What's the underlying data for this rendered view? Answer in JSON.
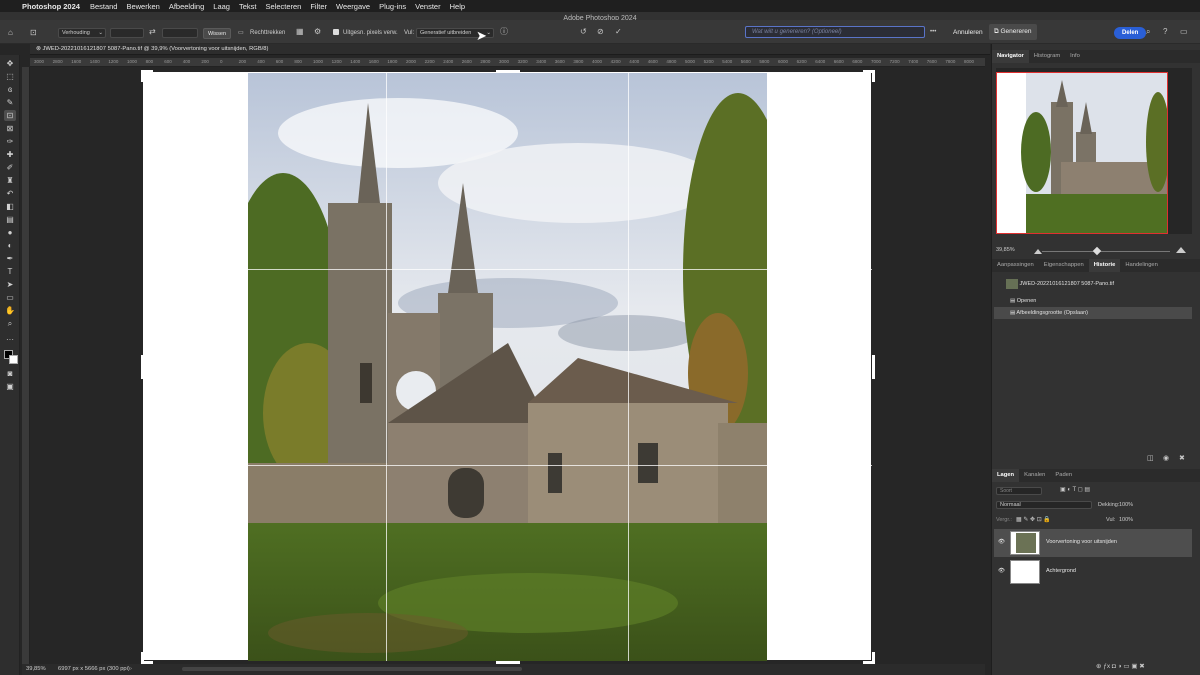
{
  "menubar": {
    "apple": "",
    "app_name": "Photoshop 2024",
    "items": [
      "Bestand",
      "Bewerken",
      "Afbeelding",
      "Laag",
      "Tekst",
      "Selecteren",
      "Filter",
      "Weergave",
      "Plug-ins",
      "Venster",
      "Help"
    ]
  },
  "window_title": "Adobe Photoshop 2024",
  "options": {
    "ratio_label": "Verhouding",
    "clear_label": "Wissen",
    "straighten_label": "Rechttrekken",
    "delete_pixels_label": "Uitgesn. pixels verw.",
    "fill_label": "Vul:",
    "fill_value": "Generatief uitbreiden",
    "prompt_placeholder": "Wat wilt u genereren? (Optioneel)",
    "more_label": "•••",
    "cancel_label": "Annuleren",
    "generate_label": "Genereren",
    "share_label": "Delen"
  },
  "document": {
    "tab_title": "JWED-20221016121807 5087-Pano.tif @ 39,9% (Voorvertoning voor uitsnijden, RGB/8)"
  },
  "ruler": {
    "ticks": [
      "3000",
      "2800",
      "1600",
      "1400",
      "1200",
      "1000",
      "800",
      "600",
      "400",
      "200",
      "0",
      "200",
      "400",
      "600",
      "800",
      "1000",
      "1200",
      "1400",
      "1600",
      "1800",
      "2000",
      "2200",
      "2400",
      "2600",
      "2800",
      "3000",
      "3200",
      "3400",
      "3600",
      "3800",
      "4000",
      "4200",
      "4400",
      "4600",
      "4800",
      "5000",
      "5200",
      "5400",
      "5600",
      "5800",
      "6000",
      "6200",
      "6400",
      "6600",
      "6800",
      "7000",
      "7200",
      "7400",
      "7600",
      "7800",
      "8000"
    ]
  },
  "status": {
    "zoom": "39,85%",
    "doc_info": "6997 px x 5666 px (300 ppi)"
  },
  "navigator": {
    "tabs": [
      "Navigator",
      "Histogram",
      "Info"
    ],
    "zoom": "39,85%"
  },
  "history_panel": {
    "tabs": [
      "Aanpassingen",
      "Eigenschappen",
      "Historie",
      "Handelingen"
    ],
    "snapshot": "JWED-20221016121807 5087-Pano.tif",
    "states": [
      "Openen",
      "Afbeeldingsgrootte (Opslaan)"
    ]
  },
  "layers_panel": {
    "tabs": [
      "Lagen",
      "Kanalen",
      "Paden"
    ],
    "search_placeholder": "Soort",
    "blend_mode": "Normaal",
    "opacity_label": "Dekking:",
    "opacity_value": "100%",
    "lock_label": "Vergr.:",
    "fill_label": "Vul:",
    "fill_value": "100%",
    "layers": [
      "Voorvertoning voor uitsnijden",
      "Achtergrond"
    ]
  },
  "colors": {
    "accent": "#2a5fd6",
    "panel": "#323232",
    "canvas_bg": "#262626"
  }
}
